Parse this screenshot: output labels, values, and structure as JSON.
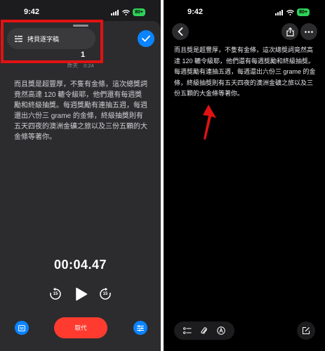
{
  "left_screen": {
    "status_time": "9:42",
    "battery": "80+",
    "copy_button_label": "拷貝逐字稿",
    "recording_number": "1",
    "recording_date": "昨天",
    "recording_length": "0:24",
    "transcript": "而且獎是超豐厚，不隻有金條，這次總獎詞竟然高達 120 轆令級耶，他們還有每週獎勵和終級抽獎。每週獎勵有連抽五週，每週還出六份三 grame 的金條，終級抽獎則有五天四夜的澳洲金礦之旅以及三份五顆的大金條等著你。",
    "timer": "00:04.47",
    "skip_back_seconds": "15",
    "skip_forward_seconds": "15",
    "cancel_label": "取代"
  },
  "right_screen": {
    "status_time": "9:42",
    "battery": "80+",
    "note_text": "而且獎是超豐厚，不隻有金條，這次總獎詞竟然高達 120 轆令級耶，他們還有每週獎勵和終級抽獎。每週獎勵有連抽五週，每週還出六份三 grame 的金條，終級抽獎則有五天四夜的澳洲金礦之旅以及三份五顆的大金條等著你。"
  },
  "colors": {
    "accent_blue": "#0a84ff",
    "cancel_red": "#ff3b30",
    "highlight_red": "#e01212",
    "battery_green": "#30d158"
  },
  "icons": [
    "copy-transcript-icon",
    "checkmark-icon",
    "skip-back-icon",
    "play-icon",
    "skip-forward-icon",
    "transcript-icon",
    "sliders-icon",
    "back-chevron-icon",
    "share-icon",
    "more-icon",
    "checklist-icon",
    "paperclip-icon",
    "markup-icon",
    "compose-icon"
  ]
}
